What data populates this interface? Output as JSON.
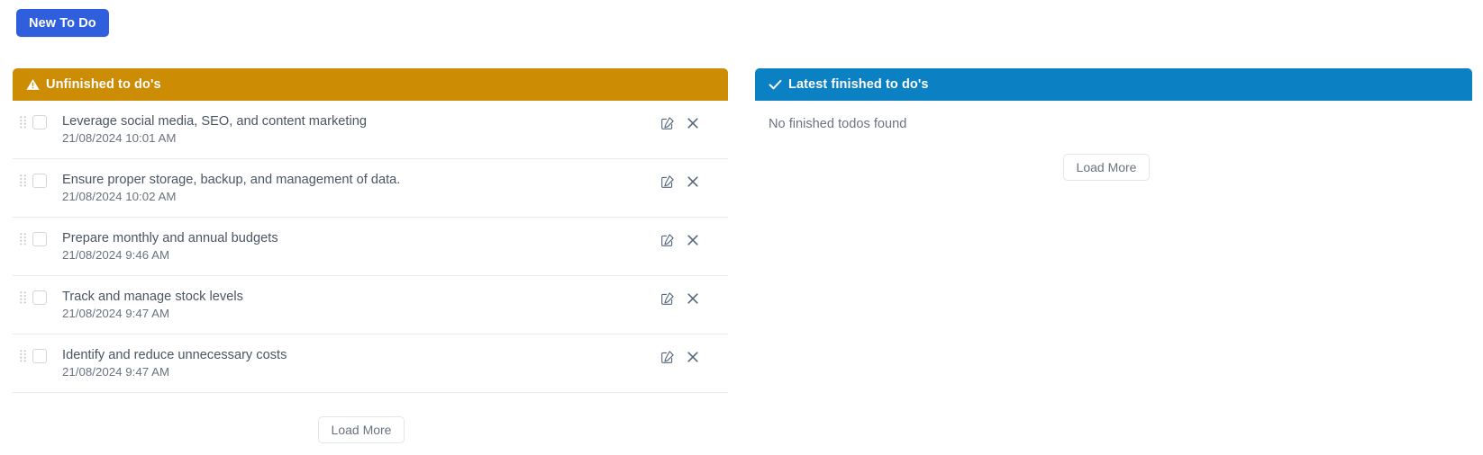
{
  "toolbar": {
    "new_todo_label": "New To Do"
  },
  "panels": {
    "unfinished": {
      "title": "Unfinished to do's",
      "header_icon": "warning-triangle-icon",
      "header_color": "#cc8c04",
      "load_more_label": "Load More",
      "items": [
        {
          "title": "Leverage social media, SEO, and content marketing",
          "date": "21/08/2024 10:01 AM",
          "checked": false
        },
        {
          "title": "Ensure proper storage, backup, and management of data.",
          "date": "21/08/2024 10:02 AM",
          "checked": false
        },
        {
          "title": "Prepare monthly and annual budgets",
          "date": "21/08/2024 9:46 AM",
          "checked": false
        },
        {
          "title": "Track and manage stock levels",
          "date": "21/08/2024 9:47 AM",
          "checked": false
        },
        {
          "title": "Identify and reduce unnecessary costs",
          "date": "21/08/2024 9:47 AM",
          "checked": false
        }
      ]
    },
    "finished": {
      "title": "Latest finished to do's",
      "header_icon": "check-icon",
      "header_color": "#0b81c4",
      "empty_message": "No finished todos found",
      "load_more_label": "Load More",
      "items": []
    }
  },
  "row_icons": {
    "edit": "edit-pencil-square-icon",
    "delete": "close-x-icon",
    "drag": "drag-handle-icon"
  }
}
